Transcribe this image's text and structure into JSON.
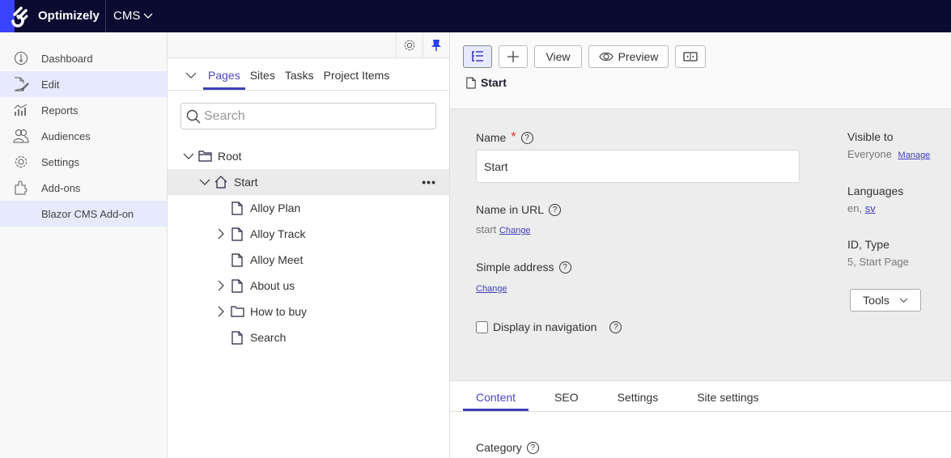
{
  "topbar": {
    "brand": "Optimizely",
    "product": "CMS"
  },
  "sidenav": {
    "items": [
      {
        "label": "Dashboard",
        "icon": "dashboard-icon"
      },
      {
        "label": "Edit",
        "icon": "edit-icon",
        "active": true
      },
      {
        "label": "Reports",
        "icon": "reports-icon"
      },
      {
        "label": "Audiences",
        "icon": "audiences-icon"
      },
      {
        "label": "Settings",
        "icon": "settings-icon"
      },
      {
        "label": "Add-ons",
        "icon": "addons-icon"
      }
    ],
    "sub_item": "Blazor CMS Add-on"
  },
  "tree_panel": {
    "tabs": [
      "Pages",
      "Sites",
      "Tasks",
      "Project Items"
    ],
    "active_tab": "Pages",
    "search_placeholder": "Search",
    "nodes": [
      {
        "label": "Root",
        "icon": "folder-icon",
        "expanded": true
      },
      {
        "label": "Start",
        "icon": "home-icon",
        "expanded": true,
        "selected": true
      },
      {
        "label": "Alloy Plan",
        "icon": "page-icon"
      },
      {
        "label": "Alloy Track",
        "icon": "page-icon",
        "has_children": true
      },
      {
        "label": "Alloy Meet",
        "icon": "page-icon"
      },
      {
        "label": "About us",
        "icon": "page-icon",
        "has_children": true
      },
      {
        "label": "How to buy",
        "icon": "folder-icon",
        "has_children": true
      },
      {
        "label": "Search",
        "icon": "page-icon"
      }
    ]
  },
  "toolbar": {
    "view_label": "View",
    "preview_label": "Preview",
    "page_title": "Start"
  },
  "properties": {
    "name_label": "Name",
    "name_value": "Start",
    "name_in_url_label": "Name in URL",
    "name_in_url_value": "start",
    "change_label": "Change",
    "simple_address_label": "Simple address",
    "display_in_nav_label": "Display in navigation",
    "display_in_nav_checked": false,
    "visible_to_label": "Visible to",
    "visible_to_value": "Everyone",
    "manage_label": "Manage",
    "languages_label": "Languages",
    "languages_value": "en,",
    "languages_link": "sv",
    "id_type_label": "ID, Type",
    "id_type_value": "5, Start Page",
    "tools_label": "Tools"
  },
  "content_tabs": [
    "Content",
    "SEO",
    "Settings",
    "Site settings"
  ],
  "active_content_tab": "Content",
  "category_label": "Category",
  "colors": {
    "accent": "#3d3fb8",
    "topbar": "#0b0a30",
    "logo_blue": "#3a44ff"
  }
}
